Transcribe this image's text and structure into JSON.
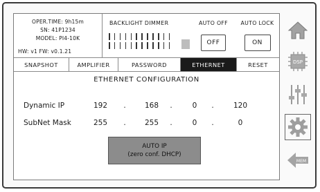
{
  "device": {
    "oper_time": "OPER.TIME: 9h15m",
    "serial": "SN: 41P1234",
    "model": "MODEL: PI4-10K",
    "hw_fw": "HW: v1   FW: v0.1.21"
  },
  "backlight": {
    "title": "BACKLIGHT DIMMER",
    "level": 1.0
  },
  "auto_off": {
    "title": "AUTO OFF",
    "value": "OFF"
  },
  "auto_lock": {
    "title": "AUTO LOCK",
    "value": "ON"
  },
  "tabs": [
    {
      "label": "SNAPSHOT",
      "active": false
    },
    {
      "label": "AMPLIFIER",
      "active": false
    },
    {
      "label": "PASSWORD",
      "active": false
    },
    {
      "label": "ETHERNET",
      "active": true
    },
    {
      "label": "RESET",
      "active": false
    }
  ],
  "ethernet": {
    "title": "ETHERNET CONFIGURATION",
    "dynamic_ip": {
      "label": "Dynamic IP",
      "octets": [
        "192",
        "168",
        "0",
        "120"
      ]
    },
    "subnet_mask": {
      "label": "SubNet Mask",
      "octets": [
        "255",
        "255",
        "0",
        "0"
      ]
    },
    "separator": ".",
    "auto_ip": {
      "line1": "AUTO IP",
      "line2": "(zero conf. DHCP)"
    }
  },
  "side_nav": {
    "items": [
      {
        "icon": "home-icon"
      },
      {
        "icon": "dsp-icon",
        "label": "DSP"
      },
      {
        "icon": "sliders-icon"
      },
      {
        "icon": "gear-icon",
        "selected": true
      },
      {
        "icon": "back-arrow-icon",
        "label": "MEM"
      }
    ]
  },
  "colors": {
    "icon_gray": "#9a9a9a",
    "active_tab_bg": "#1a1a1a",
    "auto_ip_bg": "#8c8c8c"
  }
}
